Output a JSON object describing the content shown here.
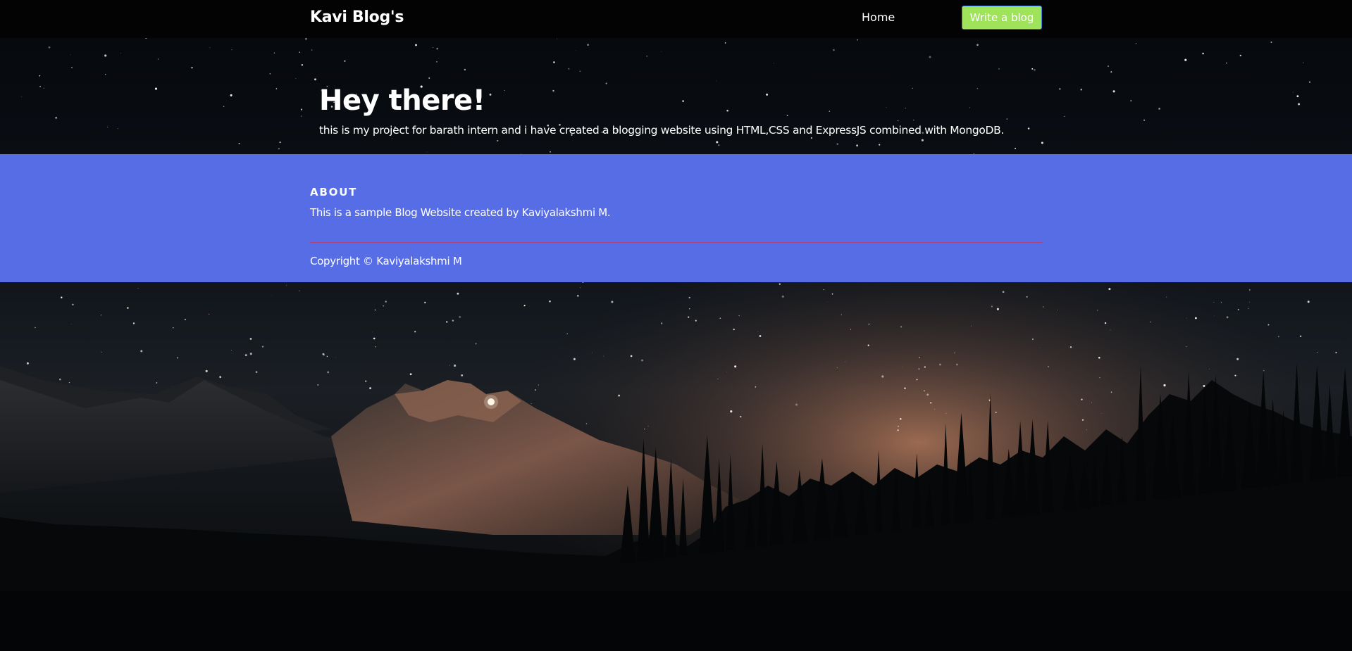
{
  "navbar": {
    "brand": "Kavi Blog's",
    "home_label": "Home",
    "write_button_label": "Write a blog"
  },
  "hero": {
    "title": "Hey there!",
    "text": "this is my project for barath intern and i have created a blogging website using HTML,CSS and ExpressJS combined with MongoDB."
  },
  "footer": {
    "about_heading": "ABOUT",
    "about_text": "This is a sample Blog Website created by Kaviyalakshmi M.",
    "copyright": "Copyright © Kaviyalakshmi M"
  },
  "colors": {
    "navbar_bg": "#030303",
    "footer_bg": "#576de6",
    "write_button_bg": "#9fe35a",
    "write_button_border": "#3d7fd6",
    "divider": "#b0407e",
    "text": "#ffffff"
  },
  "background": {
    "scene": "night-sky-mountain-forest"
  }
}
